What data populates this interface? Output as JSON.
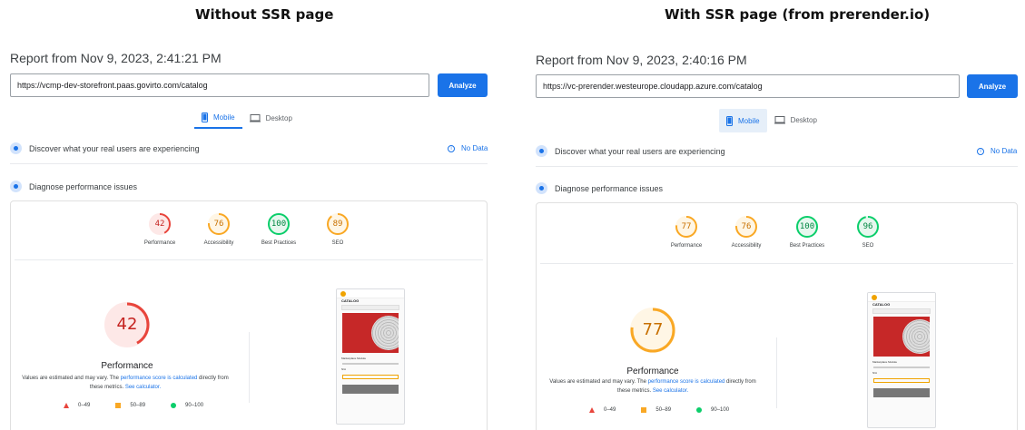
{
  "left": {
    "compare_title": "Without SSR page",
    "report_title": "Report from Nov 9, 2023, 2:41:21 PM",
    "url": "https://vcmp-dev-storefront.paas.govirto.com/catalog",
    "analyze_label": "Analyze",
    "tabs": [
      {
        "label": "Mobile",
        "active": true
      },
      {
        "label": "Desktop",
        "active": false
      }
    ],
    "discover_text": "Discover what your real users are experiencing",
    "no_data": "No Data",
    "diagnose_text": "Diagnose performance issues",
    "scores": [
      {
        "value": "42",
        "label": "Performance",
        "color": "#e8453c"
      },
      {
        "value": "76",
        "label": "Accessibility",
        "color": "#f9a825"
      },
      {
        "value": "100",
        "label": "Best Practices",
        "color": "#0cce6b"
      },
      {
        "value": "89",
        "label": "SEO",
        "color": "#f9a825"
      }
    ],
    "big_score": "42",
    "big_label": "Performance",
    "note_pre": "Values are estimated and may vary. The ",
    "note_link1": "performance score is calculated",
    "note_mid": " directly from these metrics. ",
    "note_link2": "See calculator.",
    "legend": [
      "0–49",
      "50–89",
      "90–100"
    ]
  },
  "right": {
    "compare_title": "With SSR page (from prerender.io)",
    "report_title": "Report from Nov 9, 2023, 2:40:16 PM",
    "url": "https://vc-prerender.westeurope.cloudapp.azure.com/catalog",
    "analyze_label": "Analyze",
    "tabs": [
      {
        "label": "Mobile",
        "active": true
      },
      {
        "label": "Desktop",
        "active": false
      }
    ],
    "discover_text": "Discover what your real users are experiencing",
    "no_data": "No Data",
    "diagnose_text": "Diagnose performance issues",
    "scores": [
      {
        "value": "77",
        "label": "Performance",
        "color": "#f9a825"
      },
      {
        "value": "76",
        "label": "Accessibility",
        "color": "#f9a825"
      },
      {
        "value": "100",
        "label": "Best Practices",
        "color": "#0cce6b"
      },
      {
        "value": "96",
        "label": "SEO",
        "color": "#0cce6b"
      }
    ],
    "big_score": "77",
    "big_label": "Performance",
    "note_pre": "Values are estimated and may vary. The ",
    "note_link1": "performance score is calculated",
    "note_mid": " directly from these metrics. ",
    "note_link2": "See calculator.",
    "legend": [
      "0–49",
      "50–89",
      "90–100"
    ]
  },
  "thumb": {
    "title": "CATALOG",
    "product": "Marketplace Module",
    "price": "N/A"
  }
}
